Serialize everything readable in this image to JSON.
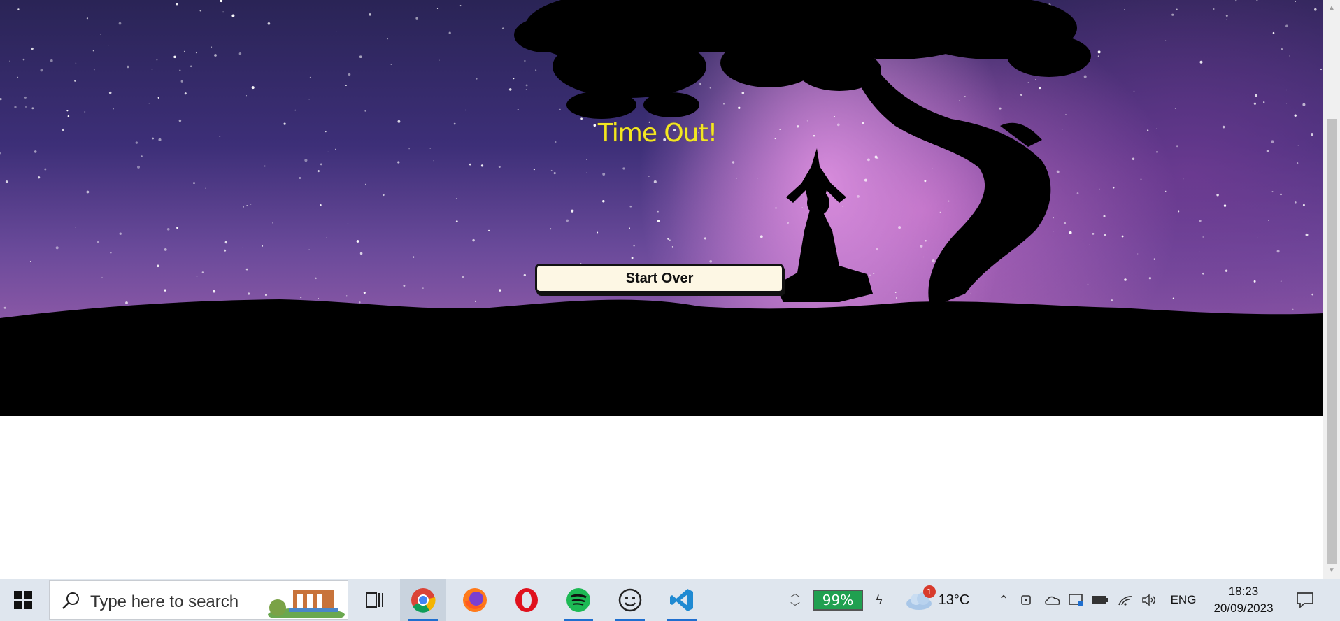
{
  "page": {
    "title": "Time Out!",
    "button_label": "Start Over"
  },
  "taskbar": {
    "search_placeholder": "Type here to search",
    "apps": [
      "chrome-icon",
      "firefox-icon",
      "opera-icon",
      "spotify-icon",
      "smiley-app-icon",
      "vscode-icon"
    ],
    "battery": "99%",
    "weather_badge": "1",
    "temperature": "13°C",
    "language": "ENG",
    "time": "18:23",
    "date": "20/09/2023"
  },
  "colors": {
    "title": "#f3e623",
    "button_bg": "#fdf7e4",
    "battery": "#20a050",
    "taskbar": "#dfe6ee"
  }
}
